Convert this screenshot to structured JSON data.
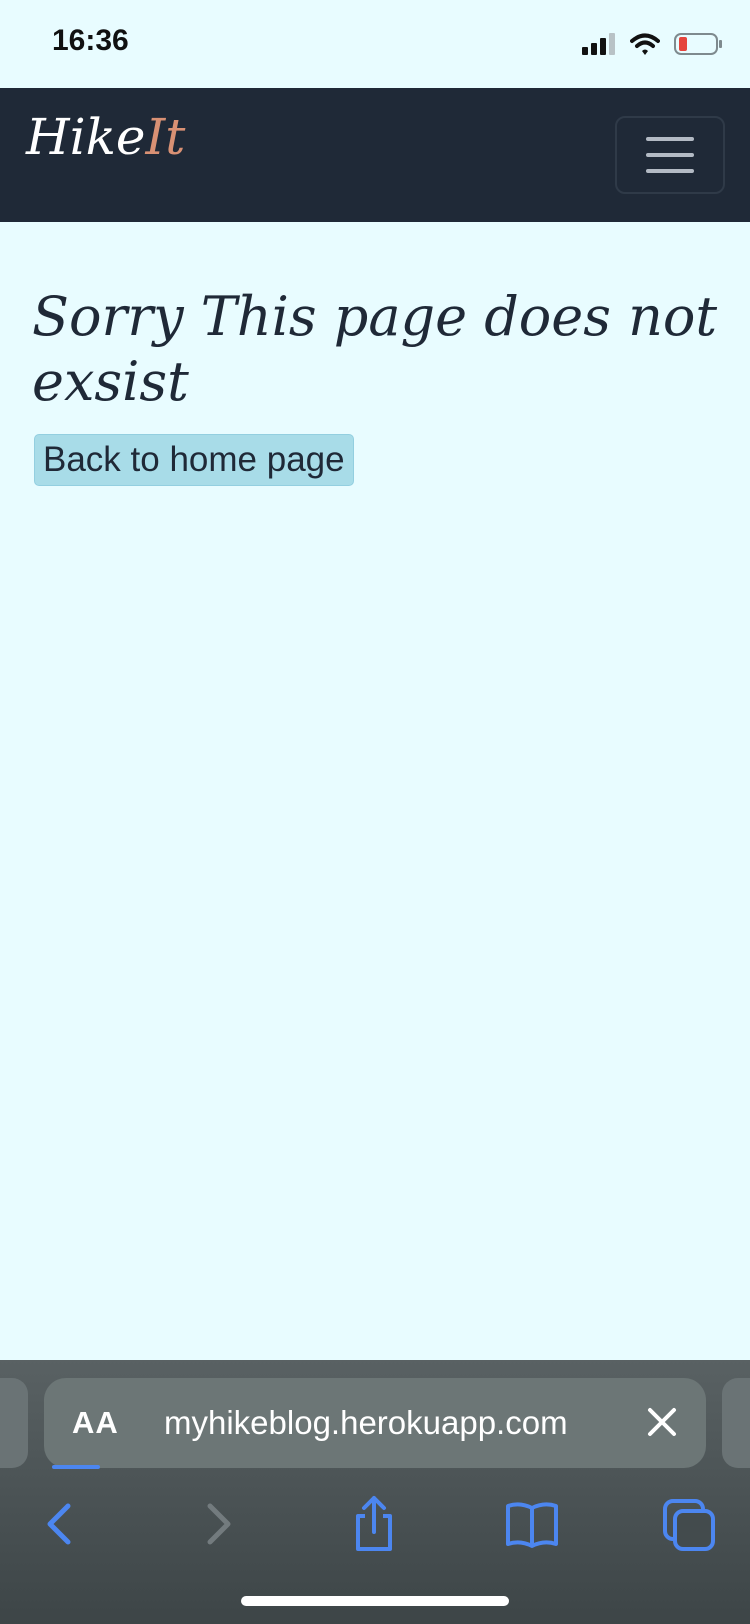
{
  "status_bar": {
    "time": "16:36"
  },
  "navbar": {
    "brand_main": "Hike",
    "brand_accent": "It",
    "accent_color": "#d99174"
  },
  "main": {
    "title": "Sorry This page does not exsist",
    "home_button_label": "Back to home page"
  },
  "browser": {
    "text_size_button": "AA",
    "url": "myhikeblog.herokuapp.com",
    "toolbar": [
      "back-icon",
      "forward-icon",
      "share-icon",
      "bookmarks-icon",
      "tabs-icon"
    ]
  },
  "colors": {
    "page_background": "#e8fcff",
    "navbar": "#1f2937",
    "button": "#a8dce8",
    "browser_accent": "#4c86f0"
  }
}
